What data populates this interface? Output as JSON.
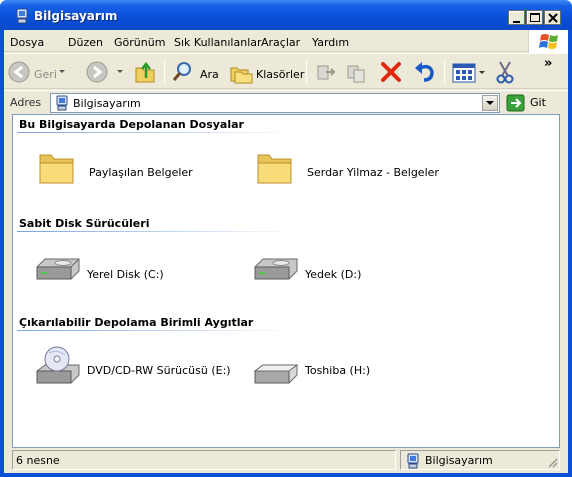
{
  "window": {
    "title": "Bilgisayarım"
  },
  "menu": [
    "Dosya",
    "Düzen",
    "Görünüm",
    "Sık Kullanılanlar",
    "Araçlar",
    "Yardım"
  ],
  "toolbar": {
    "back_label": "Geri",
    "search_label": "Ara",
    "folders_label": "Klasörler",
    "overflow": "»"
  },
  "address": {
    "label": "Adres",
    "value": "Bilgisayarım",
    "go_label": "Git"
  },
  "groups": [
    {
      "title": "Bu Bilgisayarda Depolanan Dosyalar",
      "items": [
        {
          "label": "Paylaşılan Belgeler",
          "icon": "folder-icon"
        },
        {
          "label": "Serdar Yilmaz - Belgeler",
          "icon": "folder-icon"
        }
      ]
    },
    {
      "title": "Sabit Disk Sürücüleri",
      "items": [
        {
          "label": "Yerel Disk (C:)",
          "icon": "hard-drive-icon"
        },
        {
          "label": "Yedek (D:)",
          "icon": "hard-drive-icon"
        }
      ]
    },
    {
      "title": "Çıkarılabilir Depolama Birimli Aygıtlar",
      "items": [
        {
          "label": "DVD/CD-RW Sürücüsü (E:)",
          "icon": "cd-drive-icon"
        },
        {
          "label": "Toshiba (H:)",
          "icon": "removable-drive-icon"
        }
      ]
    }
  ],
  "status": {
    "count": "6 nesne",
    "location": "Bilgisayarım"
  }
}
